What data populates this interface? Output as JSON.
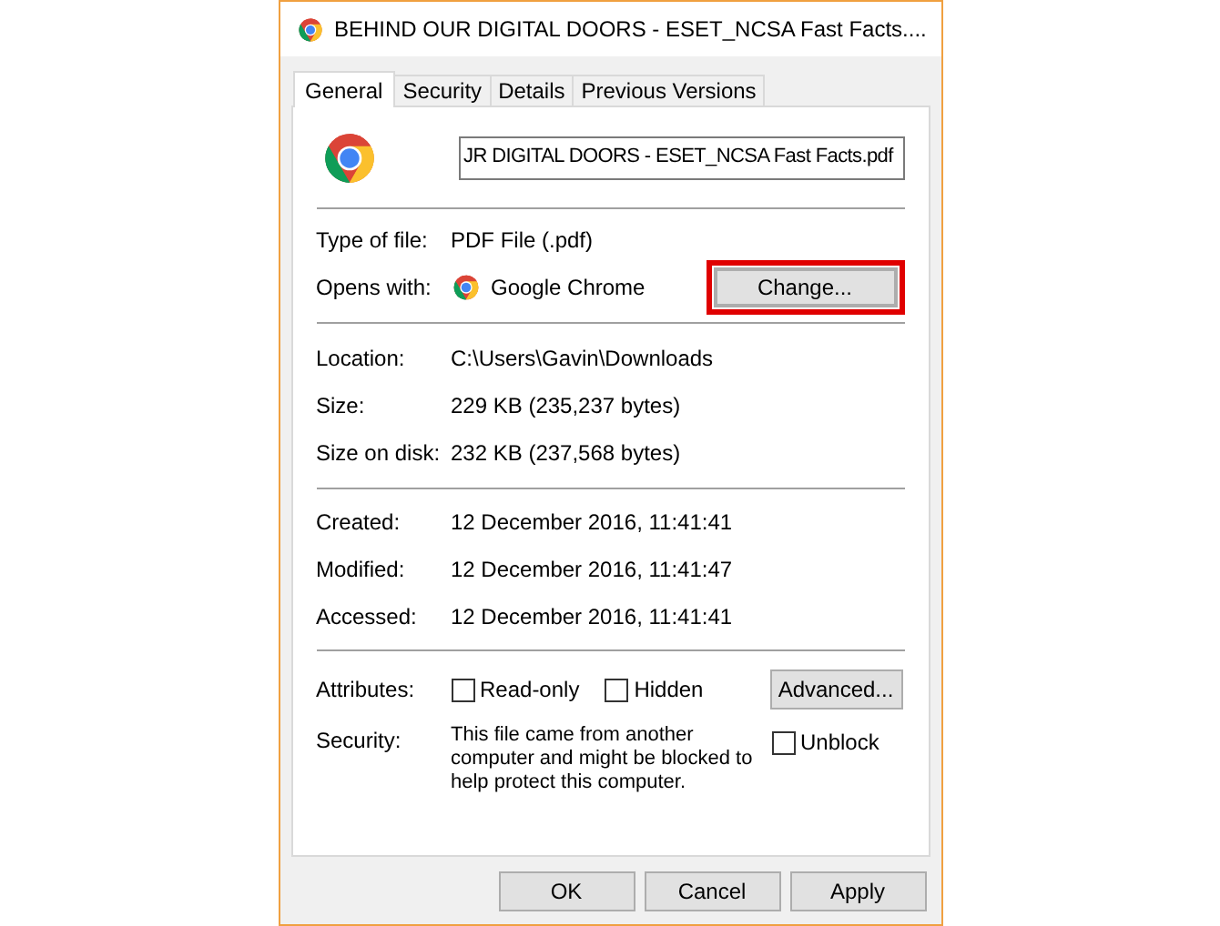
{
  "window": {
    "title": "BEHIND OUR DIGITAL DOORS - ESET_NCSA Fast Facts...."
  },
  "tabs": [
    {
      "label": "General",
      "selected": true
    },
    {
      "label": "Security",
      "selected": false
    },
    {
      "label": "Details",
      "selected": false
    },
    {
      "label": "Previous Versions",
      "selected": false
    }
  ],
  "file_name": {
    "value": "JR DIGITAL DOORS - ESET_NCSA Fast Facts.pdf"
  },
  "type_section": [
    {
      "label": "Type of file:",
      "value": "PDF File (.pdf)"
    },
    {
      "label": "Opens with:",
      "value": "Google Chrome",
      "button": "Change...",
      "highlighted": true
    }
  ],
  "location_section": [
    {
      "label": "Location:",
      "value": "C:\\Users\\Gavin\\Downloads"
    },
    {
      "label": "Size:",
      "value": "229 KB (235,237 bytes)"
    },
    {
      "label": "Size on disk:",
      "value": "232 KB (237,568 bytes)"
    }
  ],
  "dates_section": [
    {
      "label": "Created:",
      "value": "12 December 2016, 11:41:41"
    },
    {
      "label": "Modified:",
      "value": "12 December 2016, 11:41:47"
    },
    {
      "label": "Accessed:",
      "value": "12 December 2016, 11:41:41"
    }
  ],
  "attributes": {
    "label": "Attributes:",
    "checkboxes": [
      {
        "label": "Read-only",
        "checked": false
      },
      {
        "label": "Hidden",
        "checked": false
      }
    ],
    "button": "Advanced..."
  },
  "security": {
    "label": "Security:",
    "text": "This file came from another computer and might be blocked to help protect this computer.",
    "checkbox": {
      "label": "Unblock",
      "checked": false
    }
  },
  "buttons": [
    "OK",
    "Cancel",
    "Apply"
  ]
}
